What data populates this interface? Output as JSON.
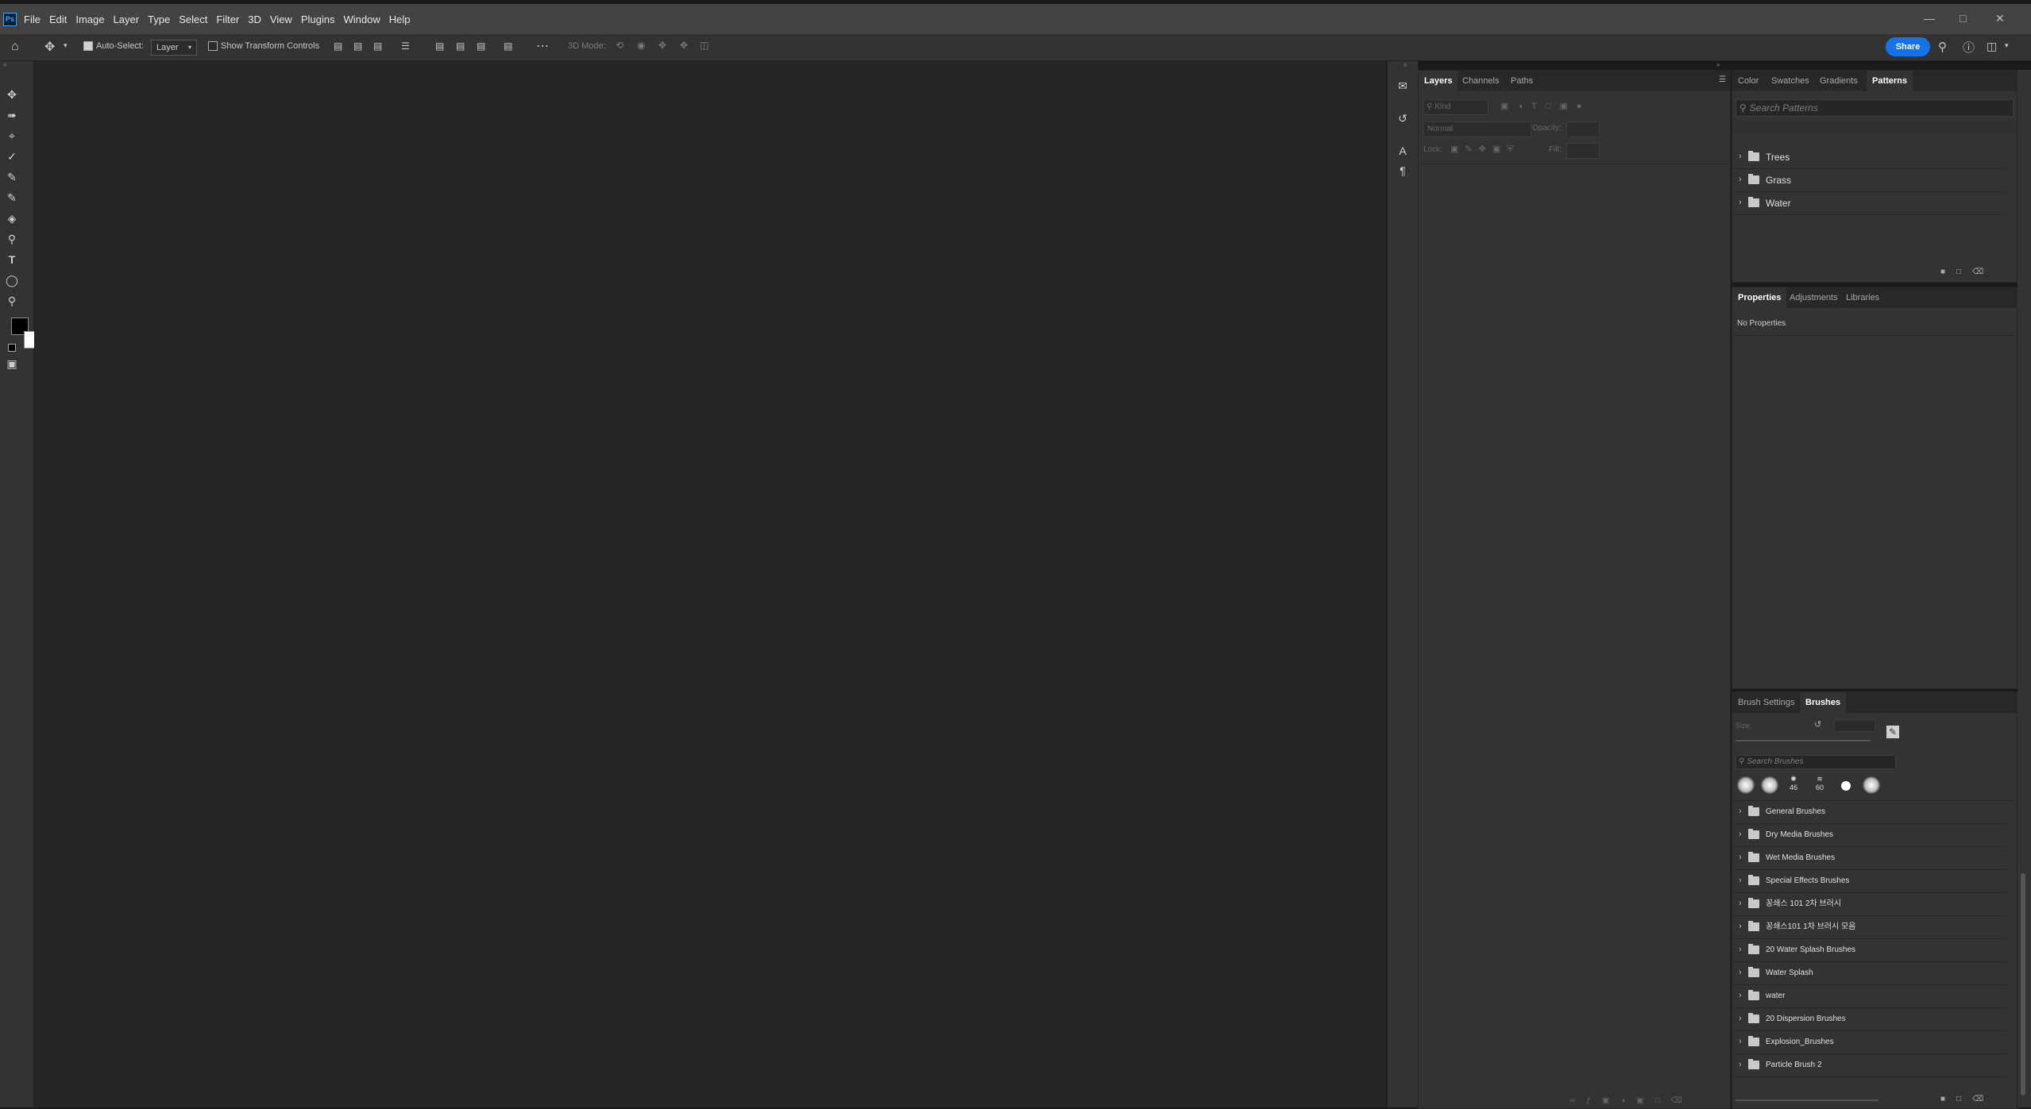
{
  "app": {
    "logo": "Ps"
  },
  "menu": [
    "File",
    "Edit",
    "Image",
    "Layer",
    "Type",
    "Select",
    "Filter",
    "3D",
    "View",
    "Plugins",
    "Window",
    "Help"
  ],
  "options": {
    "auto_select_label": "Auto-Select:",
    "auto_select_checked": true,
    "layer_dropdown": "Layer",
    "show_transform_label": "Show Transform Controls",
    "mode_label": "3D Mode:",
    "share_label": "Share"
  },
  "layers_panel": {
    "tabs": [
      "Layers",
      "Channels",
      "Paths"
    ],
    "active_tab": "Layers",
    "kind_placeholder": "Kind",
    "blend_mode": "Normal",
    "opacity_label": "Opacity:",
    "lock_label": "Lock:",
    "fill_label": "Fill:"
  },
  "patterns_panel": {
    "tabs": [
      "Color",
      "Swatches",
      "Gradients",
      "Patterns"
    ],
    "active_tab": "Patterns",
    "search_placeholder": "Search Patterns",
    "folders": [
      "Trees",
      "Grass",
      "Water"
    ]
  },
  "properties_panel": {
    "tabs": [
      "Properties",
      "Adjustments",
      "Libraries"
    ],
    "active_tab": "Properties",
    "empty_text": "No Properties"
  },
  "brushes_panel": {
    "tabs": [
      "Brush Settings",
      "Brushes"
    ],
    "active_tab": "Brushes",
    "size_label": "Size:",
    "search_placeholder": "Search Brushes",
    "recent_sizes": [
      "",
      "",
      "46",
      "60",
      "",
      ""
    ],
    "folders": [
      "General Brushes",
      "Dry Media Brushes",
      "Wet Media Brushes",
      "Special Effects Brushes",
      "꽁쇄스 101 2차 브러시",
      "꽁쇄스101 1차 브러시 모음",
      "20 Water Splash Brushes",
      "Water Splash",
      "water",
      "20 Dispersion Brushes",
      "Explosion_Brushes",
      "Particle Brush 2"
    ]
  },
  "colors": {
    "foreground": "#000000",
    "background": "#ffffff",
    "accent": "#1473e6"
  }
}
